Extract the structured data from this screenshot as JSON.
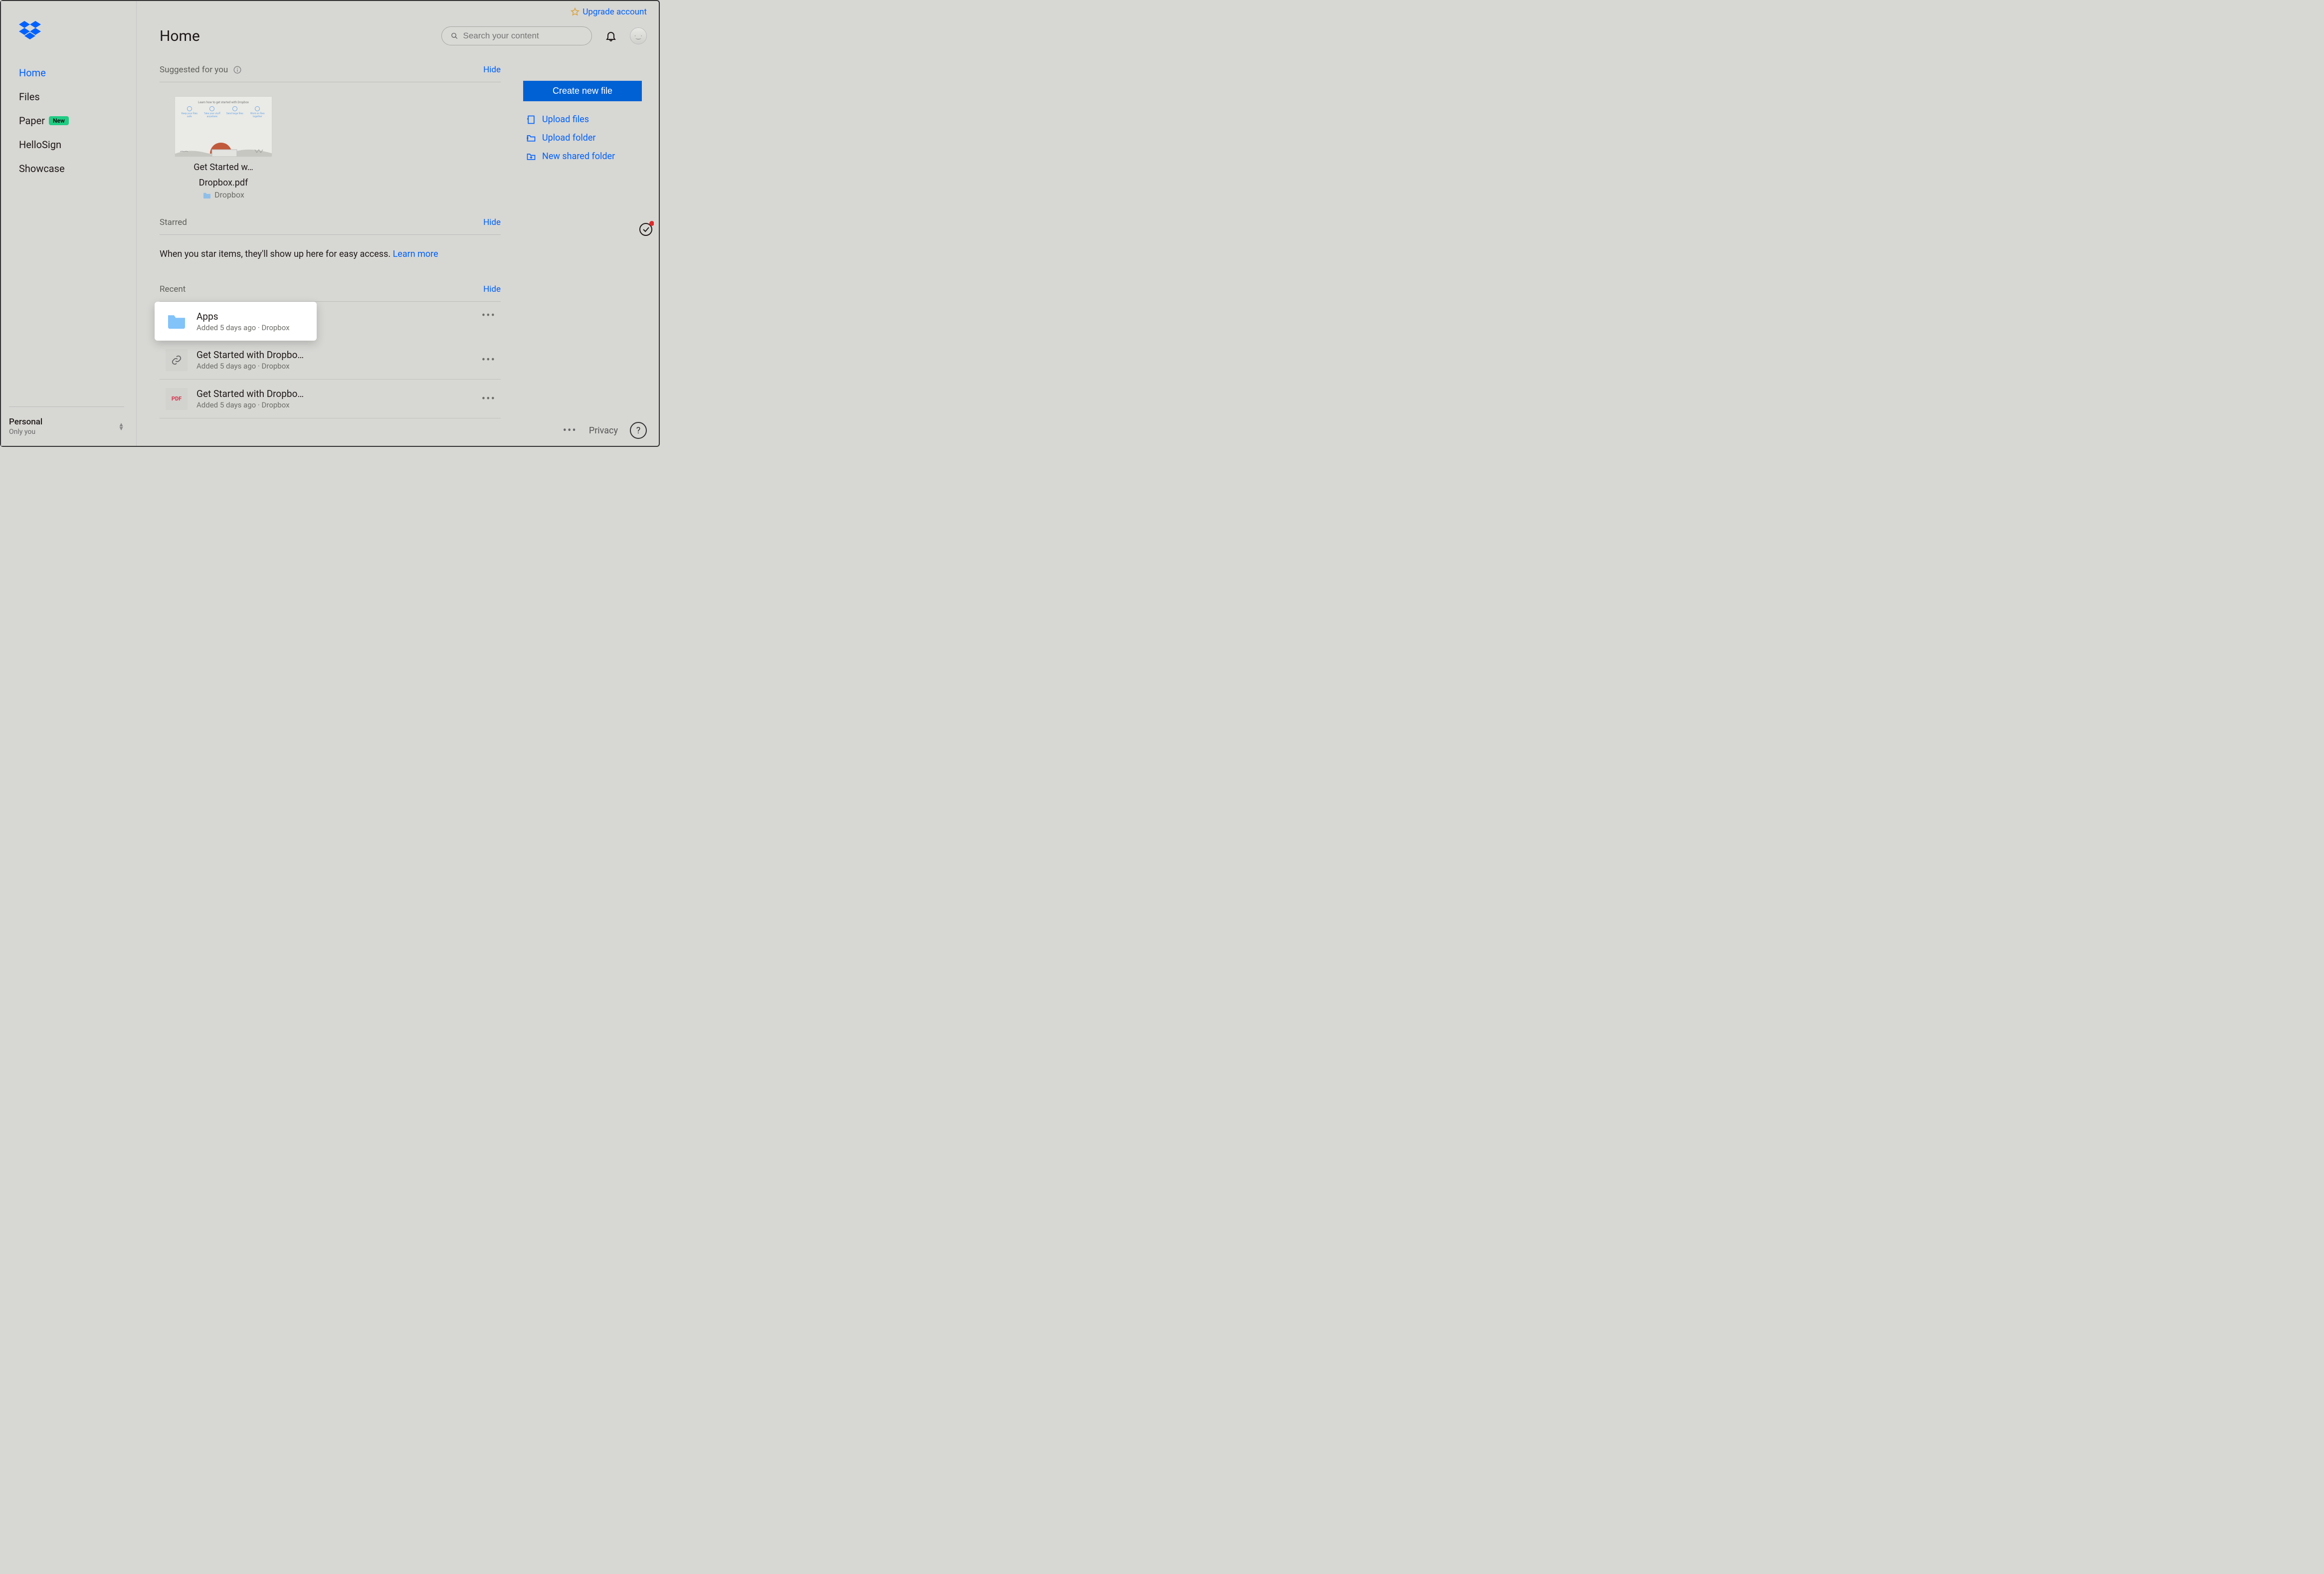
{
  "upgrade_label": "Upgrade account",
  "search": {
    "placeholder": "Search your content"
  },
  "page_title": "Home",
  "sidebar": {
    "items": [
      {
        "label": "Home"
      },
      {
        "label": "Files"
      },
      {
        "label": "Paper",
        "badge": "New"
      },
      {
        "label": "HelloSign"
      },
      {
        "label": "Showcase"
      }
    ],
    "footer": {
      "title": "Personal",
      "sub": "Only you"
    }
  },
  "sections": {
    "suggested": {
      "label": "Suggested for you",
      "hide": "Hide"
    },
    "starred": {
      "label": "Starred",
      "hide": "Hide",
      "msg": "When you star items, they'll show up here for easy access. ",
      "link": "Learn more"
    },
    "recent": {
      "label": "Recent",
      "hide": "Hide"
    }
  },
  "suggested_card": {
    "line1": "Get Started w…",
    "line2": "Dropbox.pdf",
    "loc": "Dropbox"
  },
  "recent": [
    {
      "name": "Apps",
      "meta": "Added 5 days ago · Dropbox",
      "type": "folder"
    },
    {
      "name": "Get Started with Dropbo…",
      "meta": "Added 5 days ago · Dropbox",
      "type": "link"
    },
    {
      "name": "Get Started with Dropbo…",
      "meta": "Added 5 days ago · Dropbox",
      "type": "pdf"
    }
  ],
  "actions": {
    "primary": "Create new file",
    "links": [
      {
        "label": "Upload files"
      },
      {
        "label": "Upload folder"
      },
      {
        "label": "New shared folder"
      }
    ]
  },
  "footer": {
    "privacy": "Privacy"
  }
}
